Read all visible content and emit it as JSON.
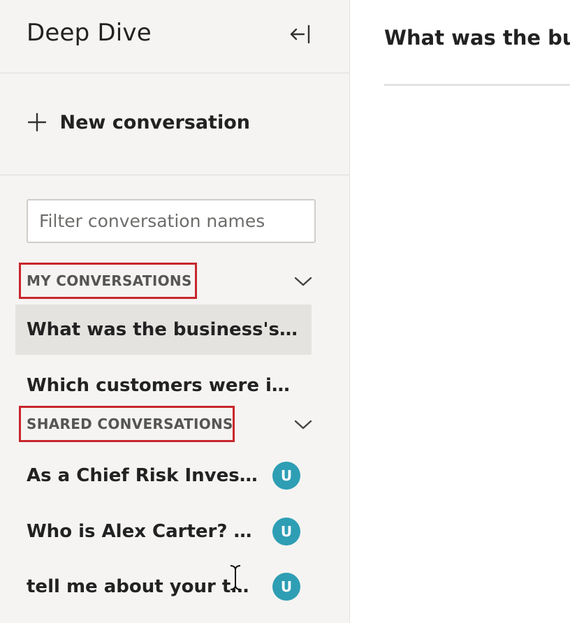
{
  "app": {
    "title": "Deep Dive"
  },
  "sidebar": {
    "collapse_icon": "collapse-left-icon",
    "new_conversation_label": "New conversation",
    "filter_placeholder": "Filter conversation names",
    "my_conversations": {
      "label": "MY CONVERSATIONS",
      "items": [
        {
          "title": "What was the business's pl…",
          "active": true
        },
        {
          "title": "Which customers were imp…",
          "active": false
        }
      ]
    },
    "shared_conversations": {
      "label": "SHARED CONVERSATIONS",
      "items": [
        {
          "title": "As a Chief Risk Investig…",
          "avatar": "U"
        },
        {
          "title": "Who is Alex Carter? Wh…",
          "avatar": "U"
        },
        {
          "title": "tell me about your too…",
          "avatar": "U"
        }
      ]
    }
  },
  "main": {
    "title": "What was the bus"
  },
  "colors": {
    "sidebar_bg": "#f5f4f2",
    "active_item_bg": "#e4e3e0",
    "highlight_border": "#c8262d",
    "avatar_bg": "#2e9eb4"
  }
}
